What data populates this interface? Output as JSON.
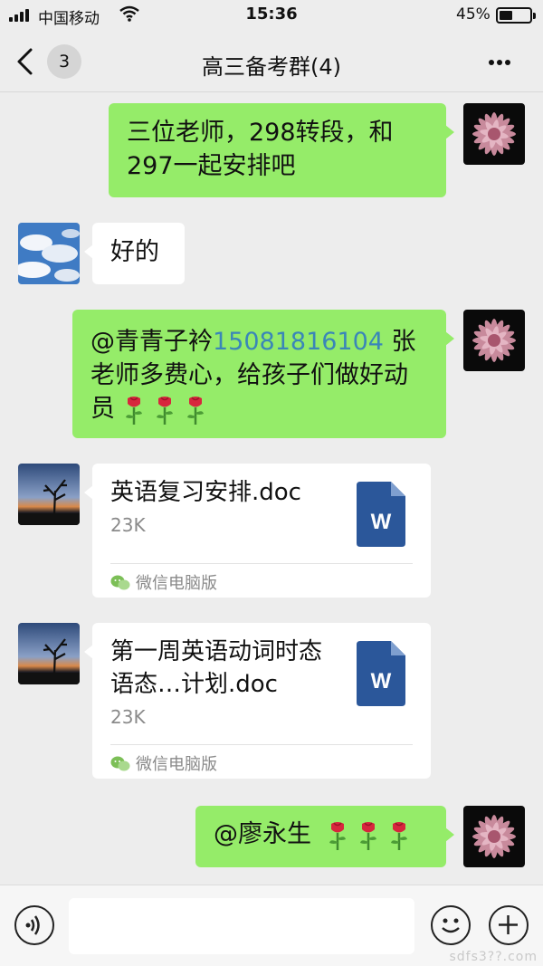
{
  "status_bar": {
    "carrier": "中国移动",
    "time": "15:36",
    "battery": "45%"
  },
  "nav": {
    "unread_count": "3",
    "title": "高三备考群(4)"
  },
  "messages": [
    {
      "text": "三位老师，298转段，和297一起安排吧"
    },
    {
      "text": "好的"
    },
    {
      "mention_prefix": "@青青子衿",
      "mention_number": "15081816104",
      "mention_rest": " 张老师多费心，给孩子们做好动员"
    },
    {
      "file_name": "英语复习安排.doc",
      "file_size": "23K",
      "source": "微信电脑版"
    },
    {
      "file_name": "第一周英语动词时态语态…计划.doc",
      "file_size": "23K",
      "source": "微信电脑版"
    },
    {
      "text": "@廖永生"
    }
  ],
  "icons": {
    "back": "chevron-left-icon",
    "more": "more-dots-icon",
    "voice": "voice-icon",
    "emoji": "emoji-icon",
    "add": "plus-icon",
    "rose": "rose-emoji-icon",
    "word": "word-doc-icon"
  },
  "colors": {
    "self_bubble": "#95ec69",
    "other_bubble": "#ffffff",
    "background": "#ededed",
    "word_blue": "#2b579a",
    "mention_link": "#3a86b8"
  },
  "watermark": "sdfs3??.com"
}
